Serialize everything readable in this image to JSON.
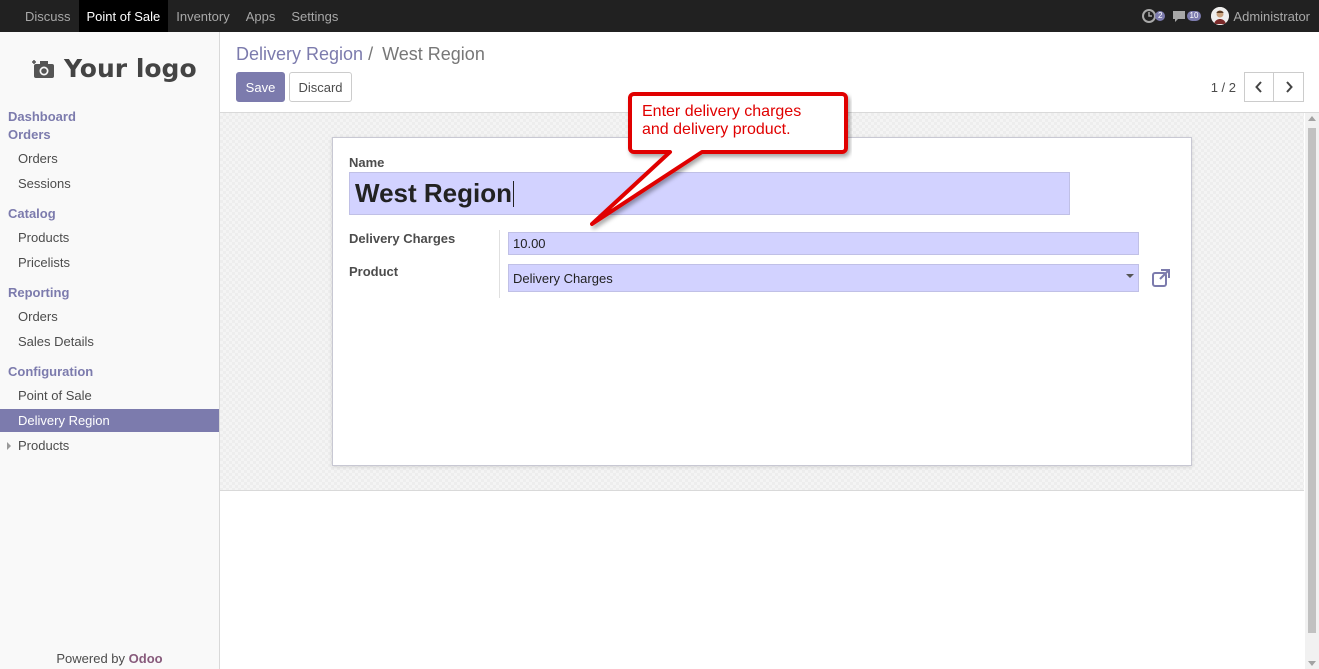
{
  "topbar": {
    "menu": [
      "Discuss",
      "Point of Sale",
      "Inventory",
      "Apps",
      "Settings"
    ],
    "active_index": 1,
    "activity_count": "2",
    "messages_count": "10",
    "user_name": "Administrator"
  },
  "sidebar": {
    "logo_text": "Your logo",
    "sections": [
      {
        "label": "Dashboard"
      },
      {
        "label": "Orders",
        "items": [
          "Orders",
          "Sessions"
        ]
      },
      {
        "label": "Catalog",
        "items": [
          "Products",
          "Pricelists"
        ]
      },
      {
        "label": "Reporting",
        "items": [
          "Orders",
          "Sales Details"
        ]
      },
      {
        "label": "Configuration",
        "items": [
          "Point of Sale",
          "Delivery Region",
          "Products"
        ]
      }
    ],
    "active_item": "Delivery Region",
    "powered_by": "Powered by",
    "powered_brand": "Odoo"
  },
  "control_panel": {
    "breadcrumb_parent": "Delivery Region",
    "breadcrumb_separator": "/",
    "breadcrumb_current": "West Region",
    "save_label": "Save",
    "discard_label": "Discard",
    "pager_value": "1 / 2"
  },
  "form": {
    "name_label": "Name",
    "name_value": "West Region",
    "delivery_charges_label": "Delivery Charges",
    "delivery_charges_value": "10.00",
    "product_label": "Product",
    "product_value": "Delivery Charges"
  },
  "callout": {
    "line1": "Enter delivery charges",
    "line2": "and delivery product."
  },
  "colors": {
    "accent": "#7c7bad",
    "topbar": "#212121",
    "field_bg": "#d2d2ff",
    "callout_red": "#e00000"
  }
}
